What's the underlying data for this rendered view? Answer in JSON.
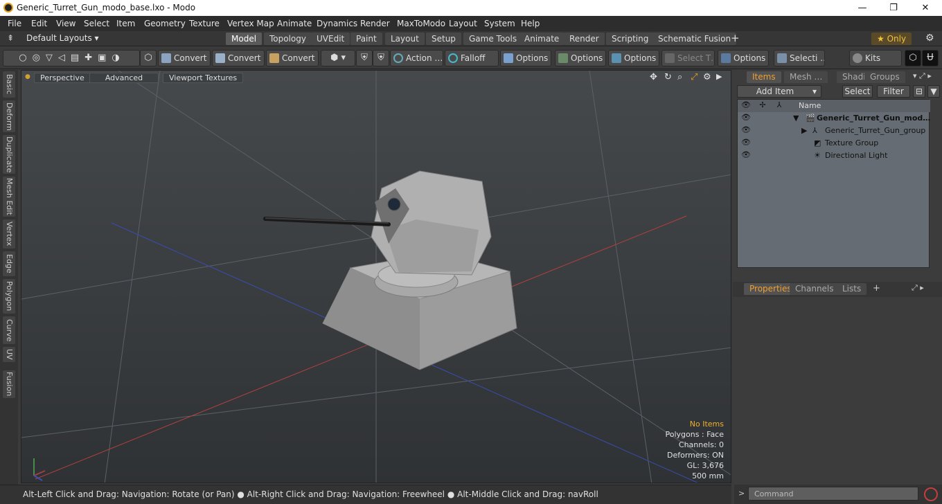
{
  "window": {
    "title": "Generic_Turret_Gun_modo_base.lxo - Modo",
    "minimize": "—",
    "maximize": "❐",
    "close": "✕"
  },
  "menu": [
    "File",
    "Edit",
    "View",
    "Select",
    "Item",
    "Geometry",
    "Texture",
    "Vertex Map",
    "Animate",
    "Dynamics",
    "Render",
    "MaxToModo",
    "Layout",
    "System",
    "Help"
  ],
  "layout_selector": "Default Layouts ▾",
  "tabs": [
    "Model",
    "Topology",
    "UVEdit",
    "Paint",
    "Layout",
    "Setup",
    "Game Tools",
    "Animate",
    "Render",
    "Scripting",
    "Schematic Fusion"
  ],
  "tab_add": "+",
  "only_label": "★  Only",
  "toolbar": {
    "convert1": "Convert",
    "convert2": "Convert",
    "convert3": "Convert",
    "action": "Action …",
    "falloff": "Falloff",
    "options1": "Options",
    "options2": "Options",
    "options3": "Options",
    "select_t": "Select T…",
    "options4": "Options",
    "selecti": "Selecti …",
    "kits": "Kits"
  },
  "left_tabs": [
    "Basic",
    "Deform",
    "Duplicate",
    "Mesh Edit",
    "Vertex",
    "Edge",
    "Polygon",
    "Curve",
    "UV",
    "Fusion"
  ],
  "viewport": {
    "buttons": [
      "Perspective",
      "Advanced",
      "Viewport Textures"
    ],
    "info": {
      "no_items": "No Items",
      "polygons": "Polygons : Face",
      "channels": "Channels: 0",
      "deformers": "Deformers: ON",
      "gl": "GL: 3,676",
      "scale": "500 mm"
    }
  },
  "status": "Alt-Left Click and Drag: Navigation: Rotate (or Pan) ● Alt-Right Click and Drag: Navigation: Freewheel ● Alt-Middle Click and Drag: navRoll",
  "right_panel": {
    "top_tabs": [
      "Items",
      "Mesh …",
      "Shading",
      "Groups"
    ],
    "add_item": "Add Item",
    "select": "Select",
    "filter": "Filter",
    "name_header": "Name",
    "items": [
      "Generic_Turret_Gun_mod…",
      "Generic_Turret_Gun_group",
      "Texture Group",
      "Directional Light"
    ],
    "bottom_tabs": [
      "Properties",
      "Channels",
      "Lists"
    ]
  },
  "command_placeholder": "Command"
}
